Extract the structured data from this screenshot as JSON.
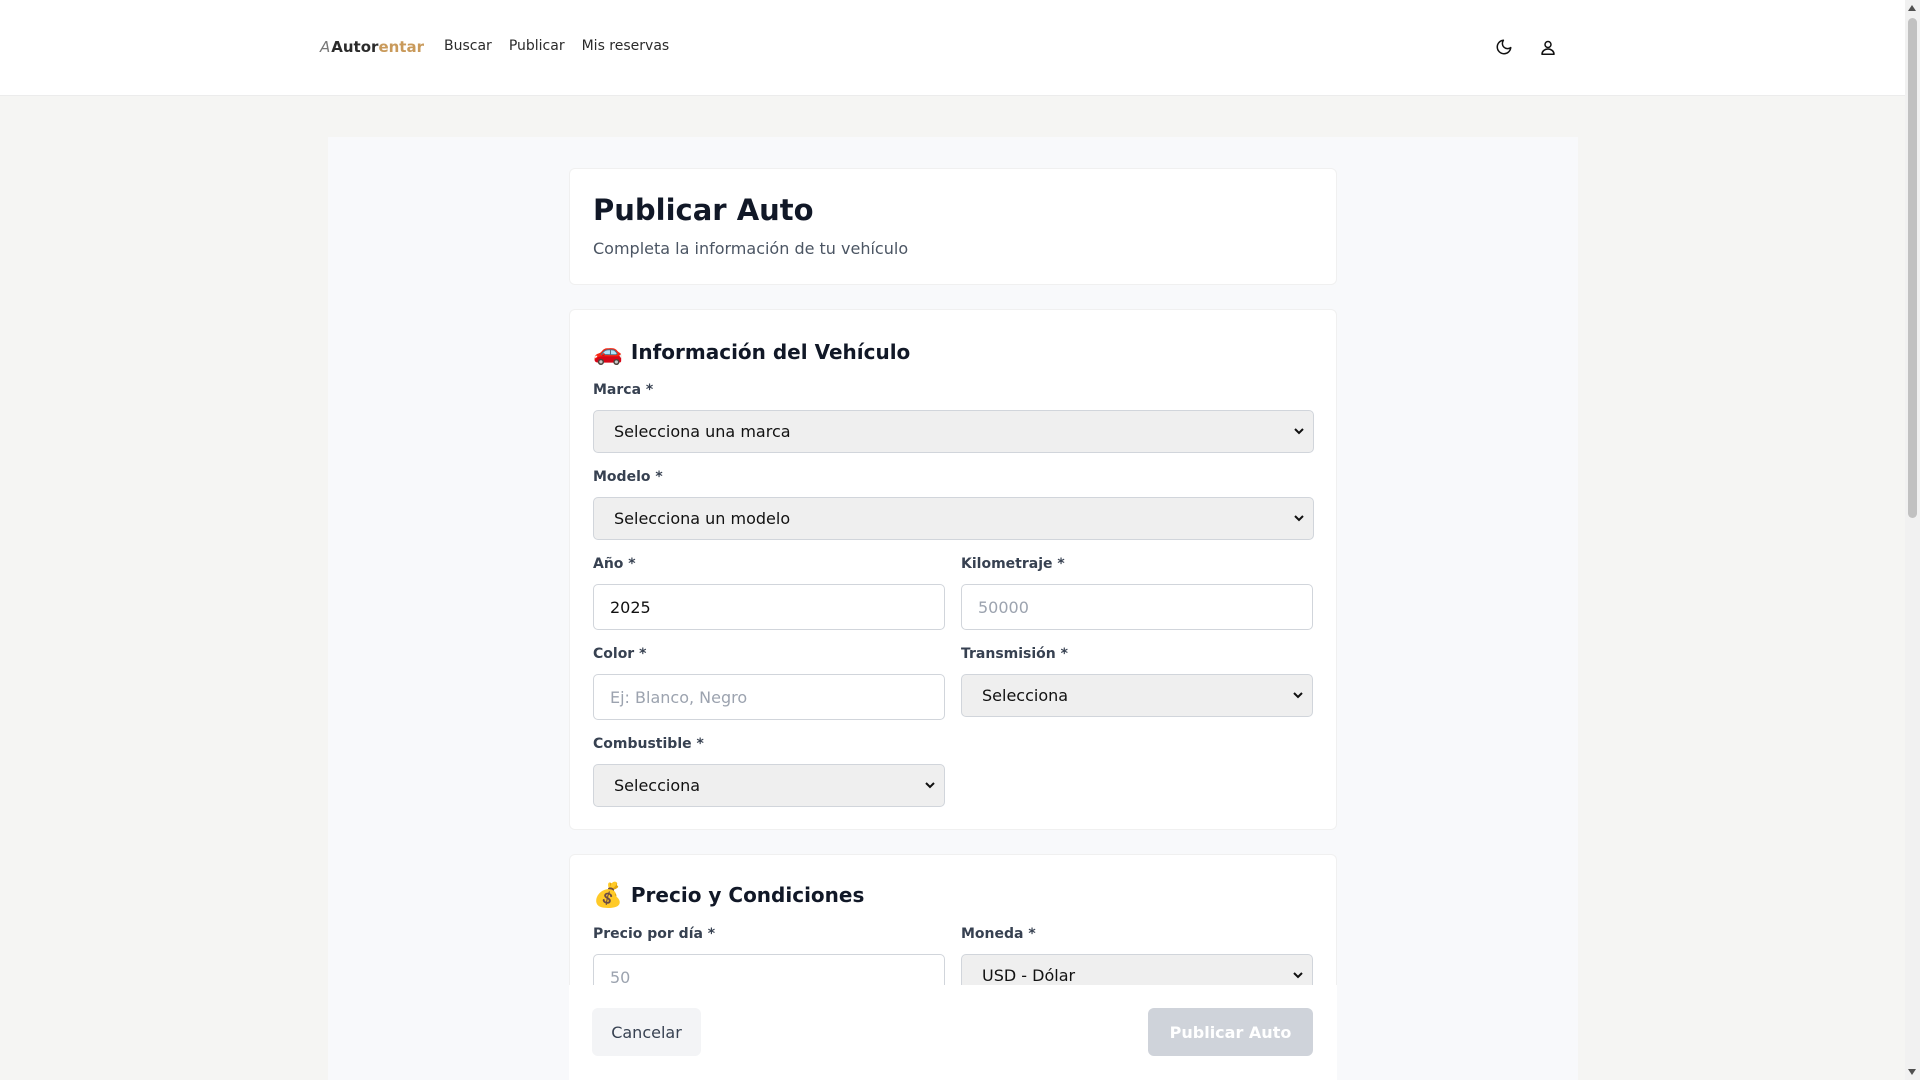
{
  "header": {
    "logo_mark": "A",
    "logo_primary": "Autor",
    "logo_accent": "entar",
    "nav": [
      "Buscar",
      "Publicar",
      "Mis reservas"
    ],
    "icons": [
      "moon-icon",
      "user-icon"
    ]
  },
  "page": {
    "title": "Publicar Auto",
    "subtitle": "Completa la información de tu vehículo"
  },
  "vehicle": {
    "emoji": "🚗",
    "title": "Información del Vehículo",
    "marca_label": "Marca *",
    "marca_value": "Selecciona una marca",
    "modelo_label": "Modelo *",
    "modelo_value": "Selecciona un modelo",
    "anio_label": "Año *",
    "anio_value": "2025",
    "km_label": "Kilometraje *",
    "km_placeholder": "50000",
    "color_label": "Color *",
    "color_placeholder": "Ej: Blanco, Negro",
    "transmision_label": "Transmisión *",
    "transmision_value": "Selecciona",
    "combustible_label": "Combustible *",
    "combustible_value": "Selecciona"
  },
  "price": {
    "emoji": "💰",
    "title": "Precio y Condiciones",
    "precio_label": "Precio por día *",
    "precio_placeholder": "50",
    "moneda_label": "Moneda *",
    "moneda_value": "USD - Dólar"
  },
  "actions": {
    "cancel": "Cancelar",
    "publish": "Publicar Auto"
  },
  "colors": {
    "accent": "#c99a5b",
    "disabled_button": "#cfd3da"
  }
}
